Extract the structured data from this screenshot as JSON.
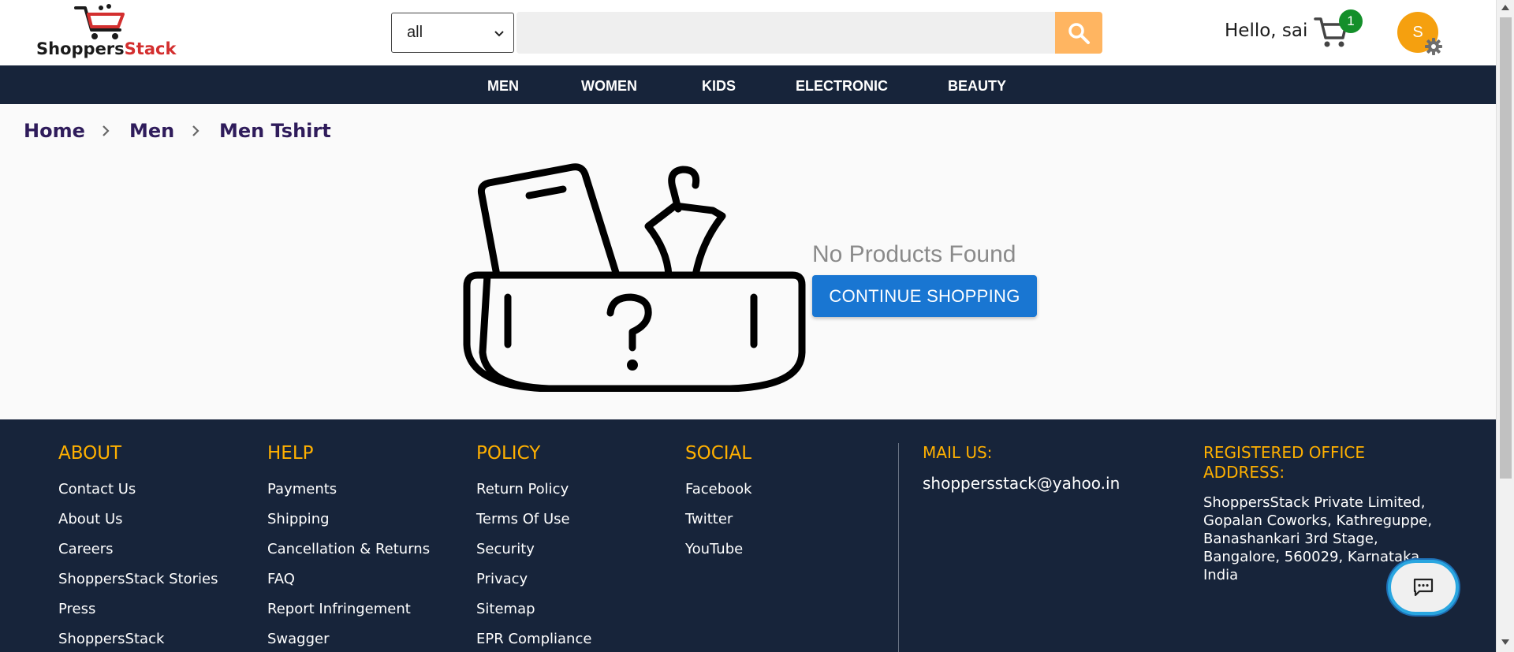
{
  "header": {
    "logo_part1": "Shoppers",
    "logo_part2": "Stack",
    "category_select_value": "all",
    "search_placeholder": "",
    "greeting": "Hello, sai",
    "cart_count": "1",
    "avatar_initial": "S"
  },
  "nav": {
    "items": [
      "MEN",
      "WOMEN",
      "KIDS",
      "ELECTRONIC",
      "BEAUTY"
    ]
  },
  "breadcrumb": [
    "Home",
    "Men",
    "Men Tshirt"
  ],
  "empty_state": {
    "message": "No Products Found",
    "button_label": "CONTINUE SHOPPING"
  },
  "footer": {
    "about": {
      "title": "ABOUT",
      "links": [
        "Contact Us",
        "About Us",
        "Careers",
        "ShoppersStack Stories",
        "Press",
        "ShoppersStack"
      ]
    },
    "help": {
      "title": "HELP",
      "links": [
        "Payments",
        "Shipping",
        "Cancellation & Returns",
        "FAQ",
        "Report Infringement",
        "Swagger"
      ]
    },
    "policy": {
      "title": "POLICY",
      "links": [
        "Return Policy",
        "Terms Of Use",
        "Security",
        "Privacy",
        "Sitemap",
        "EPR Compliance"
      ]
    },
    "social": {
      "title": "SOCIAL",
      "links": [
        "Facebook",
        "Twitter",
        "YouTube"
      ]
    },
    "mail": {
      "title": "MAIL US:",
      "email": "shoppersstack@yahoo.in"
    },
    "office": {
      "title_line1": "REGISTERED OFFICE",
      "title_line2": "ADDRESS:",
      "address": "ShoppersStack Private Limited, Gopalan Coworks, Kathreguppe, Banashankari 3rd Stage, Bangalore, 560029, Karnataka, India"
    }
  },
  "colors": {
    "nav_bg": "#17243a",
    "accent_orange": "#ffb000",
    "button_blue": "#1976d2",
    "search_btn": "#ffb561",
    "badge_green": "#148f2a"
  }
}
